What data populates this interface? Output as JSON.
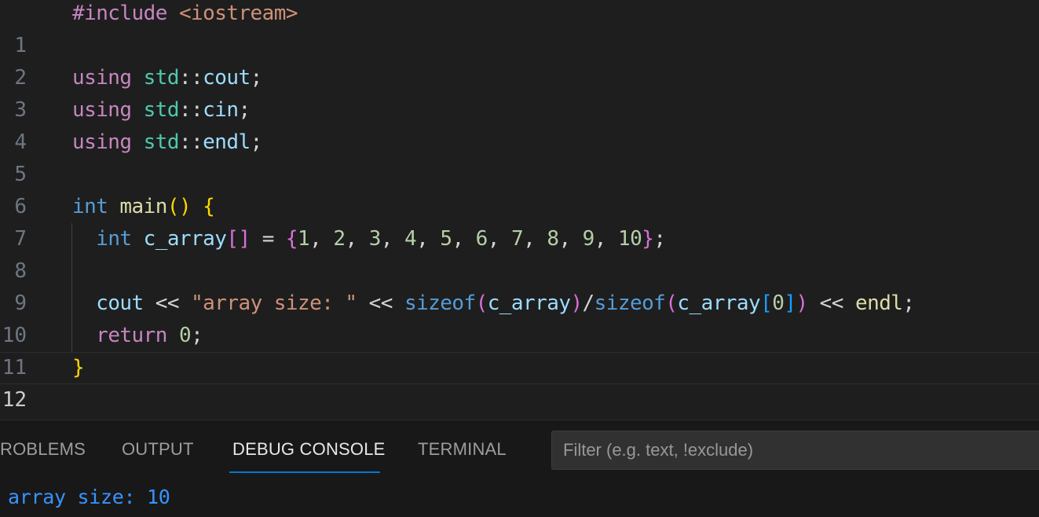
{
  "editor": {
    "line_numbers": [
      "1",
      "2",
      "3",
      "4",
      "5",
      "6",
      "7",
      "8",
      "9",
      "10",
      "11",
      "12"
    ],
    "current_line": "12",
    "code": {
      "l1": {
        "directive": "#include",
        "header": "<iostream>"
      },
      "l3": {
        "kw": "using",
        "ns": "std",
        "sep": "::",
        "name": "cout",
        "end": ";"
      },
      "l4": {
        "kw": "using",
        "ns": "std",
        "sep": "::",
        "name": "cin",
        "end": ";"
      },
      "l5": {
        "kw": "using",
        "ns": "std",
        "sep": "::",
        "name": "endl",
        "end": ";"
      },
      "l7": {
        "type": "int",
        "fn": "main",
        "parens": "()",
        "brace": "{"
      },
      "l8": {
        "type": "int",
        "var": "c_array",
        "brackets": "[]",
        "assign": "=",
        "open": "{",
        "values": [
          "1",
          "2",
          "3",
          "4",
          "5",
          "6",
          "7",
          "8",
          "9",
          "10"
        ],
        "comma": ",",
        "close": "}",
        "end": ";"
      },
      "l10": {
        "cout": "cout",
        "op": "<<",
        "str": "\"array size: \"",
        "sizeof": "sizeof",
        "paren_open": "(",
        "paren_close": ")",
        "arr": "c_array",
        "slash": "/",
        "bracket_open": "[",
        "index": "0",
        "bracket_close": "]",
        "endl": "endl",
        "end": ";"
      },
      "l11": {
        "kw": "return",
        "value": "0",
        "end": ";"
      },
      "l12": {
        "brace": "}"
      }
    }
  },
  "panel": {
    "tabs": {
      "problems": "ROBLEMS",
      "output": "OUTPUT",
      "debug_console": "DEBUG CONSOLE",
      "terminal": "TERMINAL"
    },
    "active_tab": "DEBUG CONSOLE",
    "filter_placeholder": "Filter (e.g. text, !exclude)",
    "filter_value": "",
    "console_output": "array size: 10"
  },
  "colors": {
    "editor_bg": "#1e1e1e",
    "keyword_control": "#c586c0",
    "keyword_type": "#569cd6",
    "namespace": "#4ec9b0",
    "variable": "#9cdcfe",
    "function": "#dcdcaa",
    "number": "#b5cea8",
    "string": "#ce9178",
    "bracket_level_1": "#ffd700",
    "bracket_level_2": "#da70d6",
    "bracket_level_3": "#179fff",
    "tab_underline": "#0078d4",
    "console_text": "#3794ff"
  }
}
